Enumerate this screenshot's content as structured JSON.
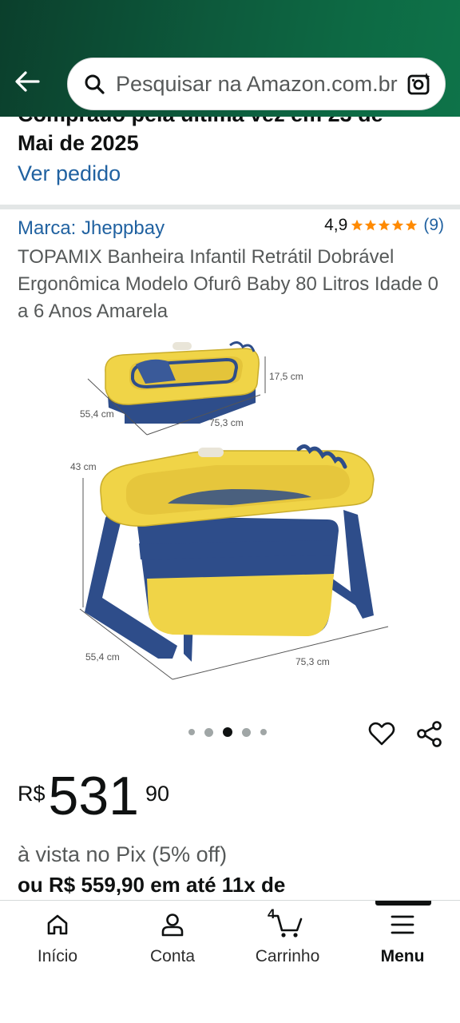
{
  "header": {
    "search_placeholder": "Pesquisar na Amazon.com.br"
  },
  "order": {
    "line1": "Comprado pela última vez em 23 de",
    "line2": "Mai de 2025",
    "link": "Ver pedido"
  },
  "product": {
    "brand": "Marca: Jheppbay",
    "rating_value": "4,9",
    "rating_stars": 5,
    "rating_count": "(9)",
    "title": "TOPAMIX Banheira Infantil Retrátil Dobrável Ergonômica Modelo Ofurô Baby 80 Litros Idade 0 a 6 Anos Amarela",
    "image": {
      "dim_depth": "55,4 cm",
      "dim_width": "75,3 cm",
      "dim_height_folded": "17,5 cm",
      "dim_height": "43 cm"
    },
    "carousel": {
      "count": 5,
      "active": 3
    }
  },
  "price": {
    "currency": "R$",
    "whole": "531",
    "fraction": "90",
    "pix": "à vista no Pix (5% off)",
    "installments": "ou R$ 559,90 em até 11x de"
  },
  "nav": {
    "items": [
      {
        "label": "Início",
        "icon": "home-icon"
      },
      {
        "label": "Conta",
        "icon": "account-icon"
      },
      {
        "label": "Carrinho",
        "icon": "cart-icon",
        "count": "4"
      },
      {
        "label": "Menu",
        "icon": "menu-icon",
        "active": true
      }
    ]
  },
  "colors": {
    "header_green": "#0d5a3c",
    "link_blue": "#2162a1",
    "star_orange": "#ff8a00",
    "tub_yellow": "#f0d447",
    "tub_blue": "#2e4d8a"
  }
}
